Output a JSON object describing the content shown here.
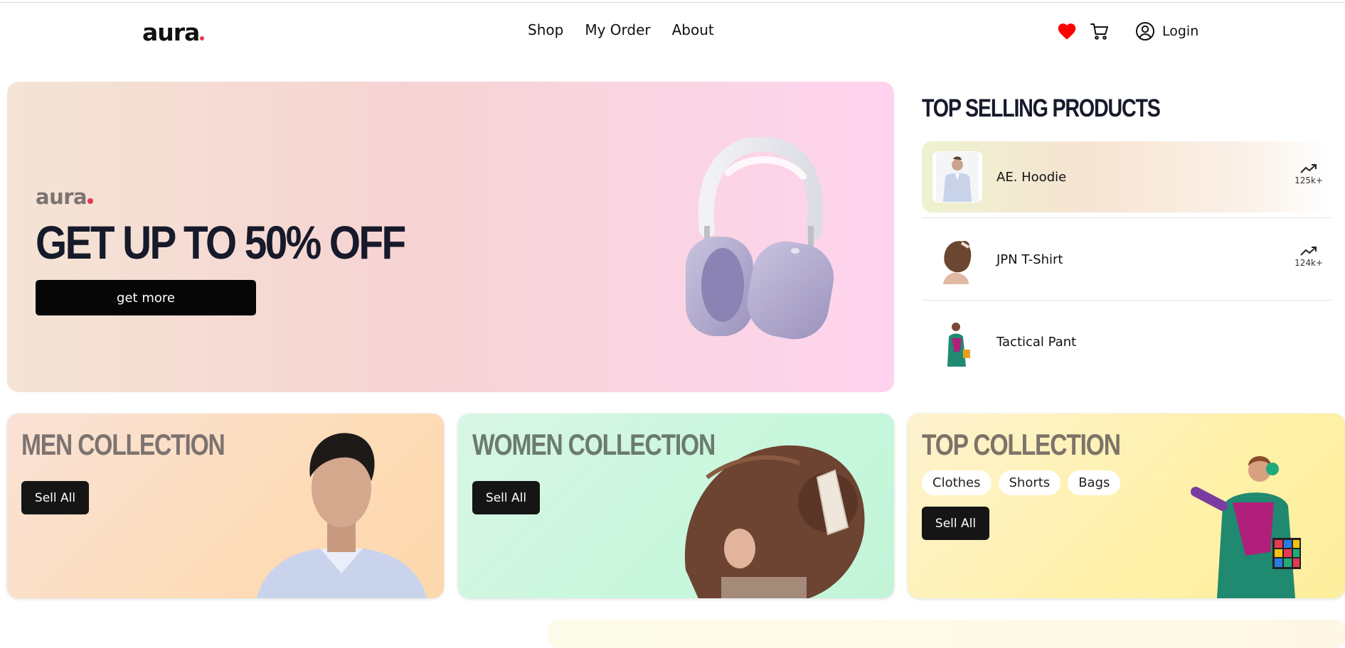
{
  "header": {
    "logo": "aura",
    "nav": [
      "Shop",
      "My Order",
      "About"
    ],
    "login_label": "Login",
    "icons": [
      "heart-icon",
      "cart-icon",
      "user-circle-icon"
    ],
    "heart_color": "#ff0000"
  },
  "hero": {
    "brand": "aura",
    "title": "GET UP TO 50% OFF",
    "button_label": "get more"
  },
  "top_selling": {
    "title": "TOP SELLING PRODUCTS",
    "items": [
      {
        "name": "AE. Hoodie",
        "count": "125k+"
      },
      {
        "name": "JPN T-Shirt",
        "count": "124k+"
      },
      {
        "name": "Tactical Pant",
        "count": ""
      }
    ]
  },
  "collections": {
    "men": {
      "title": "MEN COLLECTION",
      "button": "Sell All"
    },
    "women": {
      "title": "WOMEN COLLECTION",
      "button": "Sell All"
    },
    "top": {
      "title": "TOP COLLECTION",
      "button": "Sell All",
      "chips": [
        "Clothes",
        "Shorts",
        "Bags"
      ]
    }
  },
  "colors": {
    "accent_dot": "#e63950",
    "dark_text": "#161a2a",
    "button_bg": "#060606"
  }
}
